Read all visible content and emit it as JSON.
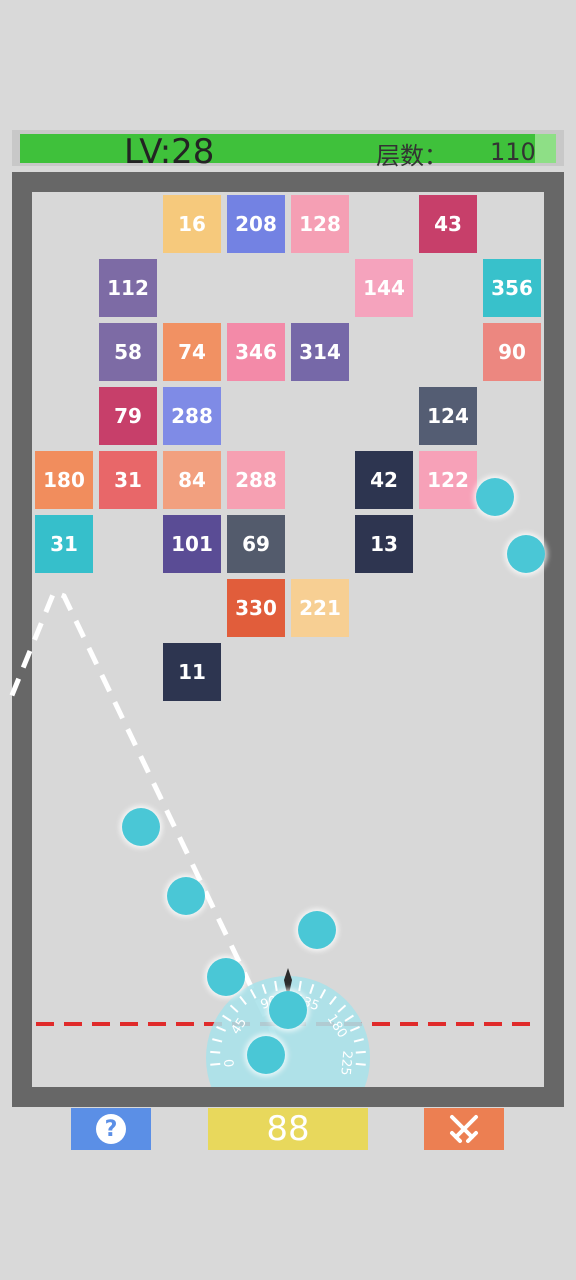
{
  "hud": {
    "level_label": "LV:28",
    "floors_label": "层数：",
    "floors_value": "110",
    "progress_fraction": 0.96
  },
  "colors": {
    "ball": "#4ac7d6",
    "danger_line": "#e02a2a",
    "progress_fill": "#3fc13b",
    "progress_track": "#8edf86"
  },
  "bricks": [
    {
      "col": 2,
      "row": 0,
      "value": "16",
      "color": "#f6c97c"
    },
    {
      "col": 3,
      "row": 0,
      "value": "208",
      "color": "#7382e3"
    },
    {
      "col": 4,
      "row": 0,
      "value": "128",
      "color": "#f59fb4"
    },
    {
      "col": 6,
      "row": 0,
      "value": "43",
      "color": "#c73f6a"
    },
    {
      "col": 1,
      "row": 1,
      "value": "112",
      "color": "#7d6ba5"
    },
    {
      "col": 5,
      "row": 1,
      "value": "144",
      "color": "#f5a3bd"
    },
    {
      "col": 7,
      "row": 1,
      "value": "356",
      "color": "#38c1cb"
    },
    {
      "col": 1,
      "row": 2,
      "value": "58",
      "color": "#7d6ba5"
    },
    {
      "col": 2,
      "row": 2,
      "value": "74",
      "color": "#f19163"
    },
    {
      "col": 3,
      "row": 2,
      "value": "346",
      "color": "#f38aa8"
    },
    {
      "col": 4,
      "row": 2,
      "value": "314",
      "color": "#7668a8"
    },
    {
      "col": 7,
      "row": 2,
      "value": "90",
      "color": "#ec8780"
    },
    {
      "col": 1,
      "row": 3,
      "value": "79",
      "color": "#c73f6a"
    },
    {
      "col": 2,
      "row": 3,
      "value": "288",
      "color": "#7f8be6"
    },
    {
      "col": 6,
      "row": 3,
      "value": "124",
      "color": "#545d73"
    },
    {
      "col": 0,
      "row": 4,
      "value": "180",
      "color": "#f18d5d"
    },
    {
      "col": 1,
      "row": 4,
      "value": "31",
      "color": "#e86769"
    },
    {
      "col": 2,
      "row": 4,
      "value": "84",
      "color": "#f2a07f"
    },
    {
      "col": 3,
      "row": 4,
      "value": "288",
      "color": "#f6a0b2"
    },
    {
      "col": 5,
      "row": 4,
      "value": "42",
      "color": "#2d3550"
    },
    {
      "col": 6,
      "row": 4,
      "value": "122",
      "color": "#f7a1b8"
    },
    {
      "col": 0,
      "row": 5,
      "value": "31",
      "color": "#36bfcb"
    },
    {
      "col": 2,
      "row": 5,
      "value": "101",
      "color": "#5a4c95"
    },
    {
      "col": 3,
      "row": 5,
      "value": "69",
      "color": "#535b6c"
    },
    {
      "col": 5,
      "row": 5,
      "value": "13",
      "color": "#2e3550"
    },
    {
      "col": 3,
      "row": 6,
      "value": "330",
      "color": "#e15d3b"
    },
    {
      "col": 4,
      "row": 6,
      "value": "221",
      "color": "#f7cf93"
    },
    {
      "col": 2,
      "row": 7,
      "value": "11",
      "color": "#2d3550"
    }
  ],
  "balls_in_flight": 8,
  "aim_dial": {
    "angle_labels": [
      "0",
      "45",
      "90",
      "135",
      "180",
      "225"
    ]
  },
  "bottom_bar": {
    "help_label": "?",
    "ball_count": "88",
    "battle_icon": "crossed-swords-icon",
    "help_icon": "question-icon"
  }
}
